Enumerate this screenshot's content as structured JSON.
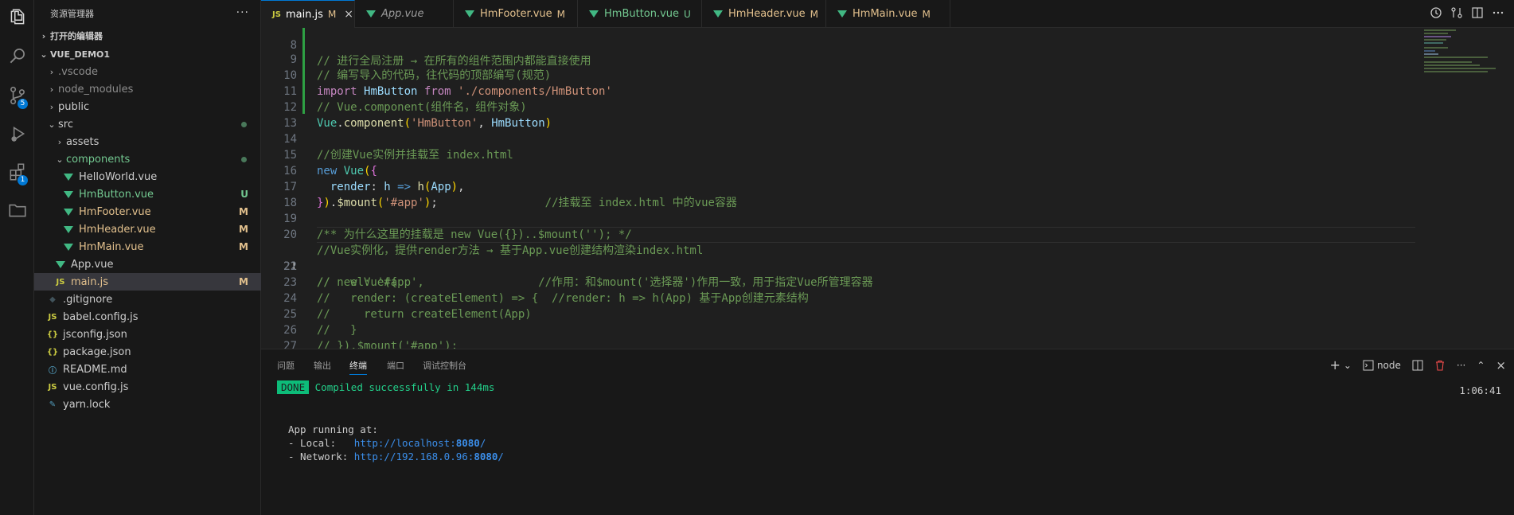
{
  "sidebar": {
    "title": "资源管理器",
    "more": "···",
    "open_editors": "打开的编辑器",
    "project": "VUE_DEMO1",
    "items": [
      {
        "label": ".vscode"
      },
      {
        "label": "node_modules"
      },
      {
        "label": "public"
      },
      {
        "label": "src"
      },
      {
        "label": "assets"
      },
      {
        "label": "components"
      },
      {
        "label": "HelloWorld.vue"
      },
      {
        "label": "HmButton.vue",
        "status": "U"
      },
      {
        "label": "HmFooter.vue",
        "status": "M"
      },
      {
        "label": "HmHeader.vue",
        "status": "M"
      },
      {
        "label": "HmMain.vue",
        "status": "M"
      },
      {
        "label": "App.vue"
      },
      {
        "label": "main.js",
        "status": "M"
      },
      {
        "label": ".gitignore"
      },
      {
        "label": "babel.config.js"
      },
      {
        "label": "jsconfig.json"
      },
      {
        "label": "package.json"
      },
      {
        "label": "README.md"
      },
      {
        "label": "vue.config.js"
      },
      {
        "label": "yarn.lock"
      }
    ]
  },
  "activity": {
    "scm_badge": "5",
    "ext_badge": "1"
  },
  "tabs": [
    {
      "label": "main.js",
      "status": "M",
      "icon": "JS"
    },
    {
      "label": "App.vue",
      "status": ""
    },
    {
      "label": "HmFooter.vue",
      "status": "M"
    },
    {
      "label": "HmButton.vue",
      "status": "U"
    },
    {
      "label": "HmHeader.vue",
      "status": "M"
    },
    {
      "label": "HmMain.vue",
      "status": "M"
    }
  ],
  "editor": {
    "line_numbers": [
      "8",
      "9",
      "10",
      "11",
      "12",
      "13",
      "14",
      "15",
      "16",
      "17",
      "18",
      "19",
      "20",
      "21",
      "22",
      "23",
      "24",
      "25",
      "26",
      "27"
    ],
    "tokens": {
      "l8": "// 进行全局注册 → 在所有的组件范围内都能直接使用",
      "l9": "// 编写导入的代码，往代码的顶部编写(规范)",
      "l10_kw": "import",
      "l10_var": "HmButton",
      "l10_from": "from",
      "l10_str": "'./components/HmButton'",
      "l11": "// Vue.component(组件名，组件对象)",
      "l12_cls": "Vue",
      "l12_fn": "component",
      "l12_str": "'HmButton'",
      "l12_var": "HmButton",
      "l14": "//创建Vue实例并挂载至 index.html",
      "l15_kw": "new",
      "l15_cls": "Vue",
      "l16_var": "render",
      "l16_h": "h",
      "l16_arrow": "=>",
      "l16_fn": "h",
      "l16_app": "App",
      "l17_fn": "$mount",
      "l17_str": "'#app'",
      "l17_com": "//挂载至 index.html 中的vue容器",
      "l19": "/** 为什么这里的挂载是 new Vue({})..$mount(''); */",
      "l20": "//Vue实例化，提供render方法 → 基于App.vue创建结构渲染index.html",
      "l21": "// new Vue({",
      "l22": "//   el: '#app',                 //作用：和$mount('选择器')作用一致，用于指定Vue所管理容器",
      "l23": "//   render: (createElement) => {  //render: h => h(App) 基于App创建元素结构",
      "l24": "//     return createElement(App)",
      "l25": "//   }",
      "l26": "// }).$mount('#app');"
    }
  },
  "panel": {
    "tabs": [
      "问题",
      "输出",
      "终端",
      "端口",
      "调试控制台"
    ],
    "active_tab": "终端",
    "shell": "node",
    "terminal": {
      "done": "DONE",
      "compiled": "Compiled successfully in 144ms",
      "time": "1:06:41",
      "running": "App running at:",
      "local_label": "- Local:   ",
      "local_url_a": "http://localhost:",
      "local_port": "8080",
      "local_url_b": "/",
      "network_label": "- Network: ",
      "network_url_a": "http://192.168.0.96:",
      "network_port": "8080",
      "network_url_b": "/"
    }
  }
}
